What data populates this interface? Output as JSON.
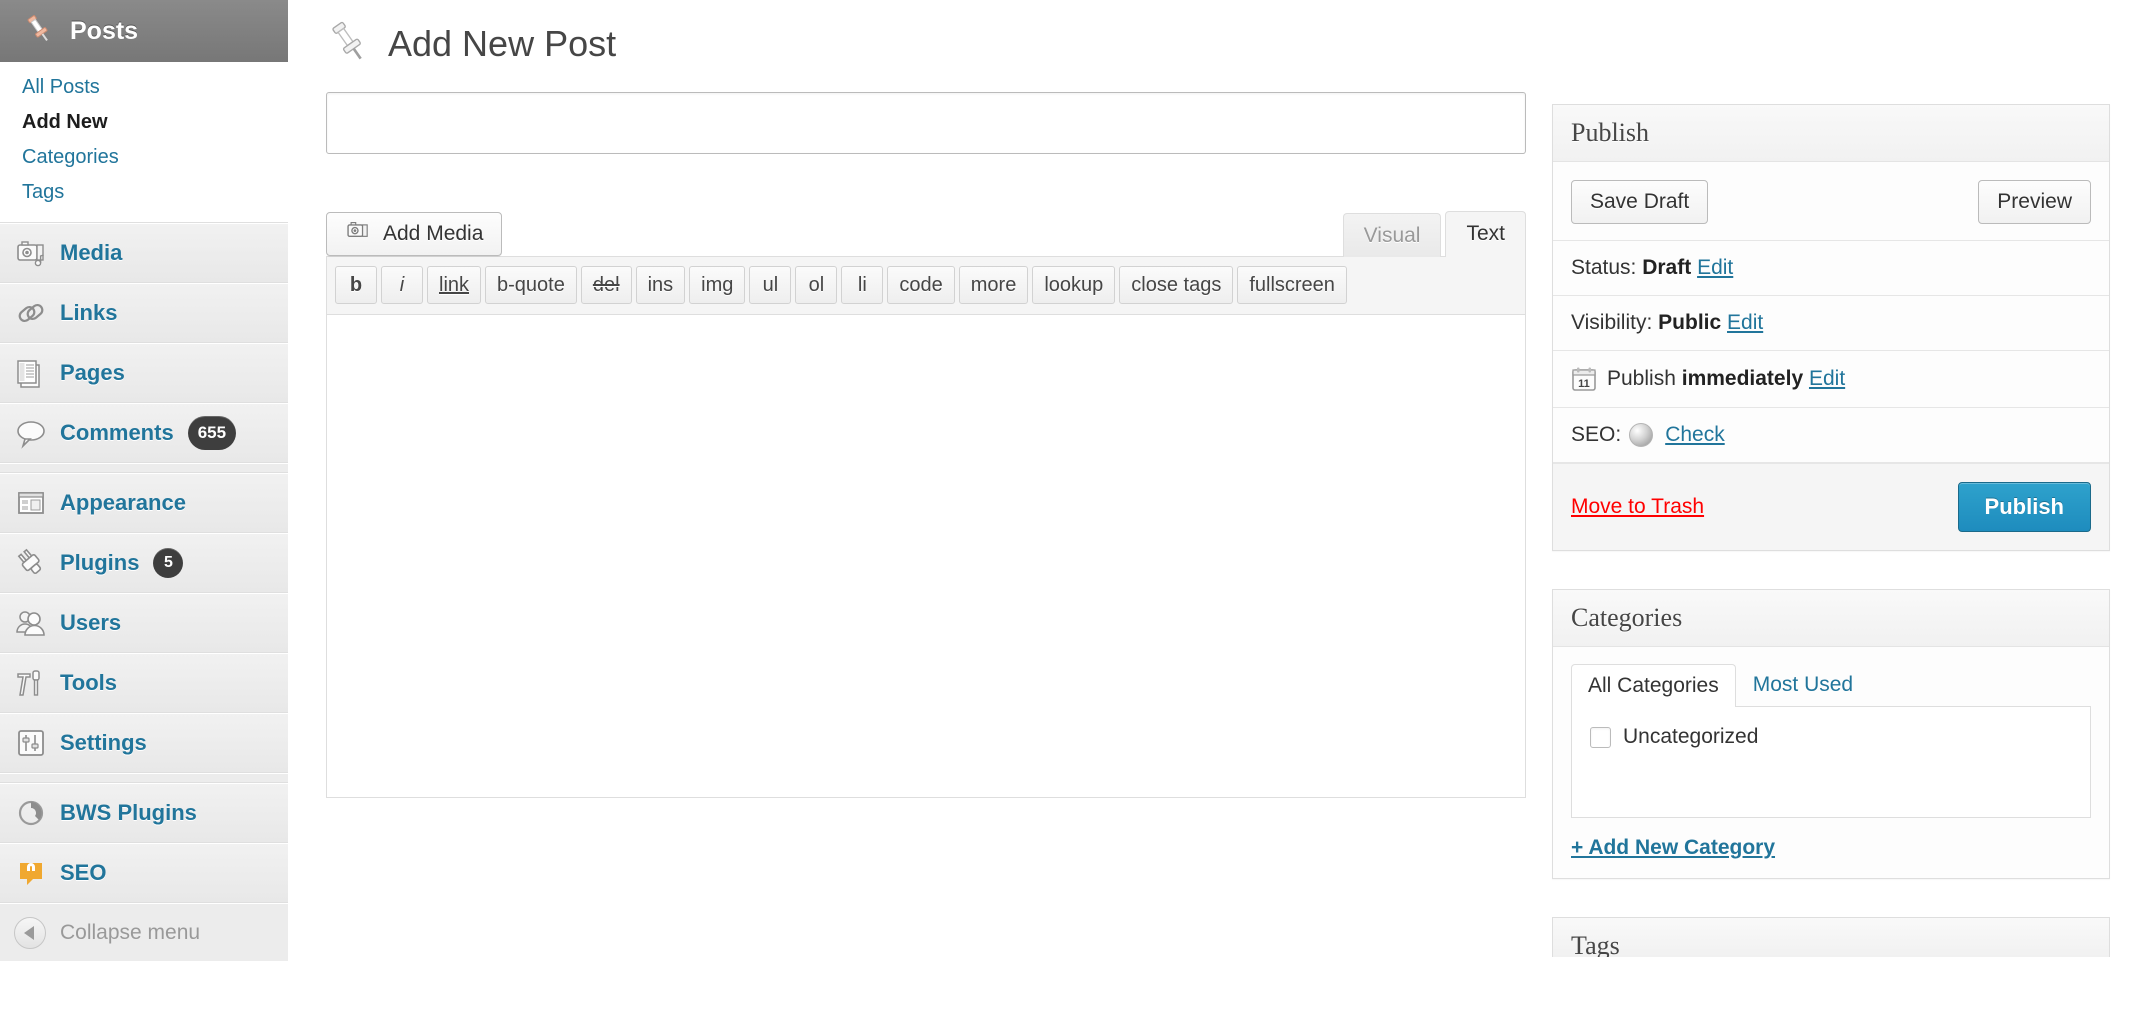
{
  "sidebar": {
    "current_menu": {
      "label": "Posts",
      "icon": "pushpin-icon"
    },
    "submenu": [
      {
        "label": "All Posts",
        "current": false
      },
      {
        "label": "Add New",
        "current": true
      },
      {
        "label": "Categories",
        "current": false
      },
      {
        "label": "Tags",
        "current": false
      }
    ],
    "items": [
      {
        "label": "Media",
        "icon": "media-icon",
        "badge": ""
      },
      {
        "label": "Links",
        "icon": "link-icon",
        "badge": ""
      },
      {
        "label": "Pages",
        "icon": "pages-icon",
        "badge": ""
      },
      {
        "label": "Comments",
        "icon": "comment-icon",
        "badge": "655"
      },
      {
        "label": "Appearance",
        "icon": "appearance-icon",
        "badge": ""
      },
      {
        "label": "Plugins",
        "icon": "plugin-icon",
        "badge": "5"
      },
      {
        "label": "Users",
        "icon": "users-icon",
        "badge": ""
      },
      {
        "label": "Tools",
        "icon": "tools-icon",
        "badge": ""
      },
      {
        "label": "Settings",
        "icon": "settings-icon",
        "badge": ""
      },
      {
        "label": "BWS Plugins",
        "icon": "bws-icon",
        "badge": ""
      },
      {
        "label": "SEO",
        "icon": "seo-icon",
        "badge": ""
      }
    ],
    "collapse": {
      "label": "Collapse menu",
      "icon": "chevron-left-circle-icon"
    }
  },
  "header": {
    "title": "Add New Post",
    "icon": "pushpin-icon"
  },
  "editor": {
    "title_value": "",
    "title_placeholder": "",
    "add_media_label": "Add Media",
    "add_media_icon": "media-icon",
    "tabs": [
      {
        "label": "Visual",
        "active": false
      },
      {
        "label": "Text",
        "active": true
      }
    ],
    "quicktags": [
      {
        "label": "b",
        "style": "bold"
      },
      {
        "label": "i",
        "style": "italic"
      },
      {
        "label": "link",
        "style": "underline"
      },
      {
        "label": "b-quote",
        "style": "normal"
      },
      {
        "label": "del",
        "style": "strike"
      },
      {
        "label": "ins",
        "style": "normal"
      },
      {
        "label": "img",
        "style": "normal"
      },
      {
        "label": "ul",
        "style": "normal"
      },
      {
        "label": "ol",
        "style": "normal"
      },
      {
        "label": "li",
        "style": "normal"
      },
      {
        "label": "code",
        "style": "normal"
      },
      {
        "label": "more",
        "style": "normal"
      },
      {
        "label": "lookup",
        "style": "normal"
      },
      {
        "label": "close tags",
        "style": "normal"
      },
      {
        "label": "fullscreen",
        "style": "normal"
      }
    ],
    "body_value": ""
  },
  "publish": {
    "heading": "Publish",
    "save_draft_label": "Save Draft",
    "preview_label": "Preview",
    "status_label": "Status:",
    "status_value": "Draft",
    "status_edit": "Edit",
    "visibility_label": "Visibility:",
    "visibility_value": "Public",
    "visibility_edit": "Edit",
    "schedule_prefix": "Publish",
    "schedule_value": "immediately",
    "schedule_edit": "Edit",
    "calendar_day": "11",
    "seo_label": "SEO:",
    "seo_check": "Check",
    "seo_indicator": "gray",
    "trash_label": "Move to Trash",
    "publish_label": "Publish"
  },
  "categories": {
    "heading": "Categories",
    "tabs": [
      {
        "label": "All Categories",
        "active": true
      },
      {
        "label": "Most Used",
        "active": false
      }
    ],
    "items": [
      {
        "label": "Uncategorized",
        "checked": false
      }
    ],
    "add_new_label": "+ Add New Category"
  },
  "tags": {
    "heading": "Tags"
  },
  "colors": {
    "link": "#21759b",
    "primary": "#1e8cbe",
    "danger": "#ff0000",
    "menu_active_bg": "#777777"
  }
}
